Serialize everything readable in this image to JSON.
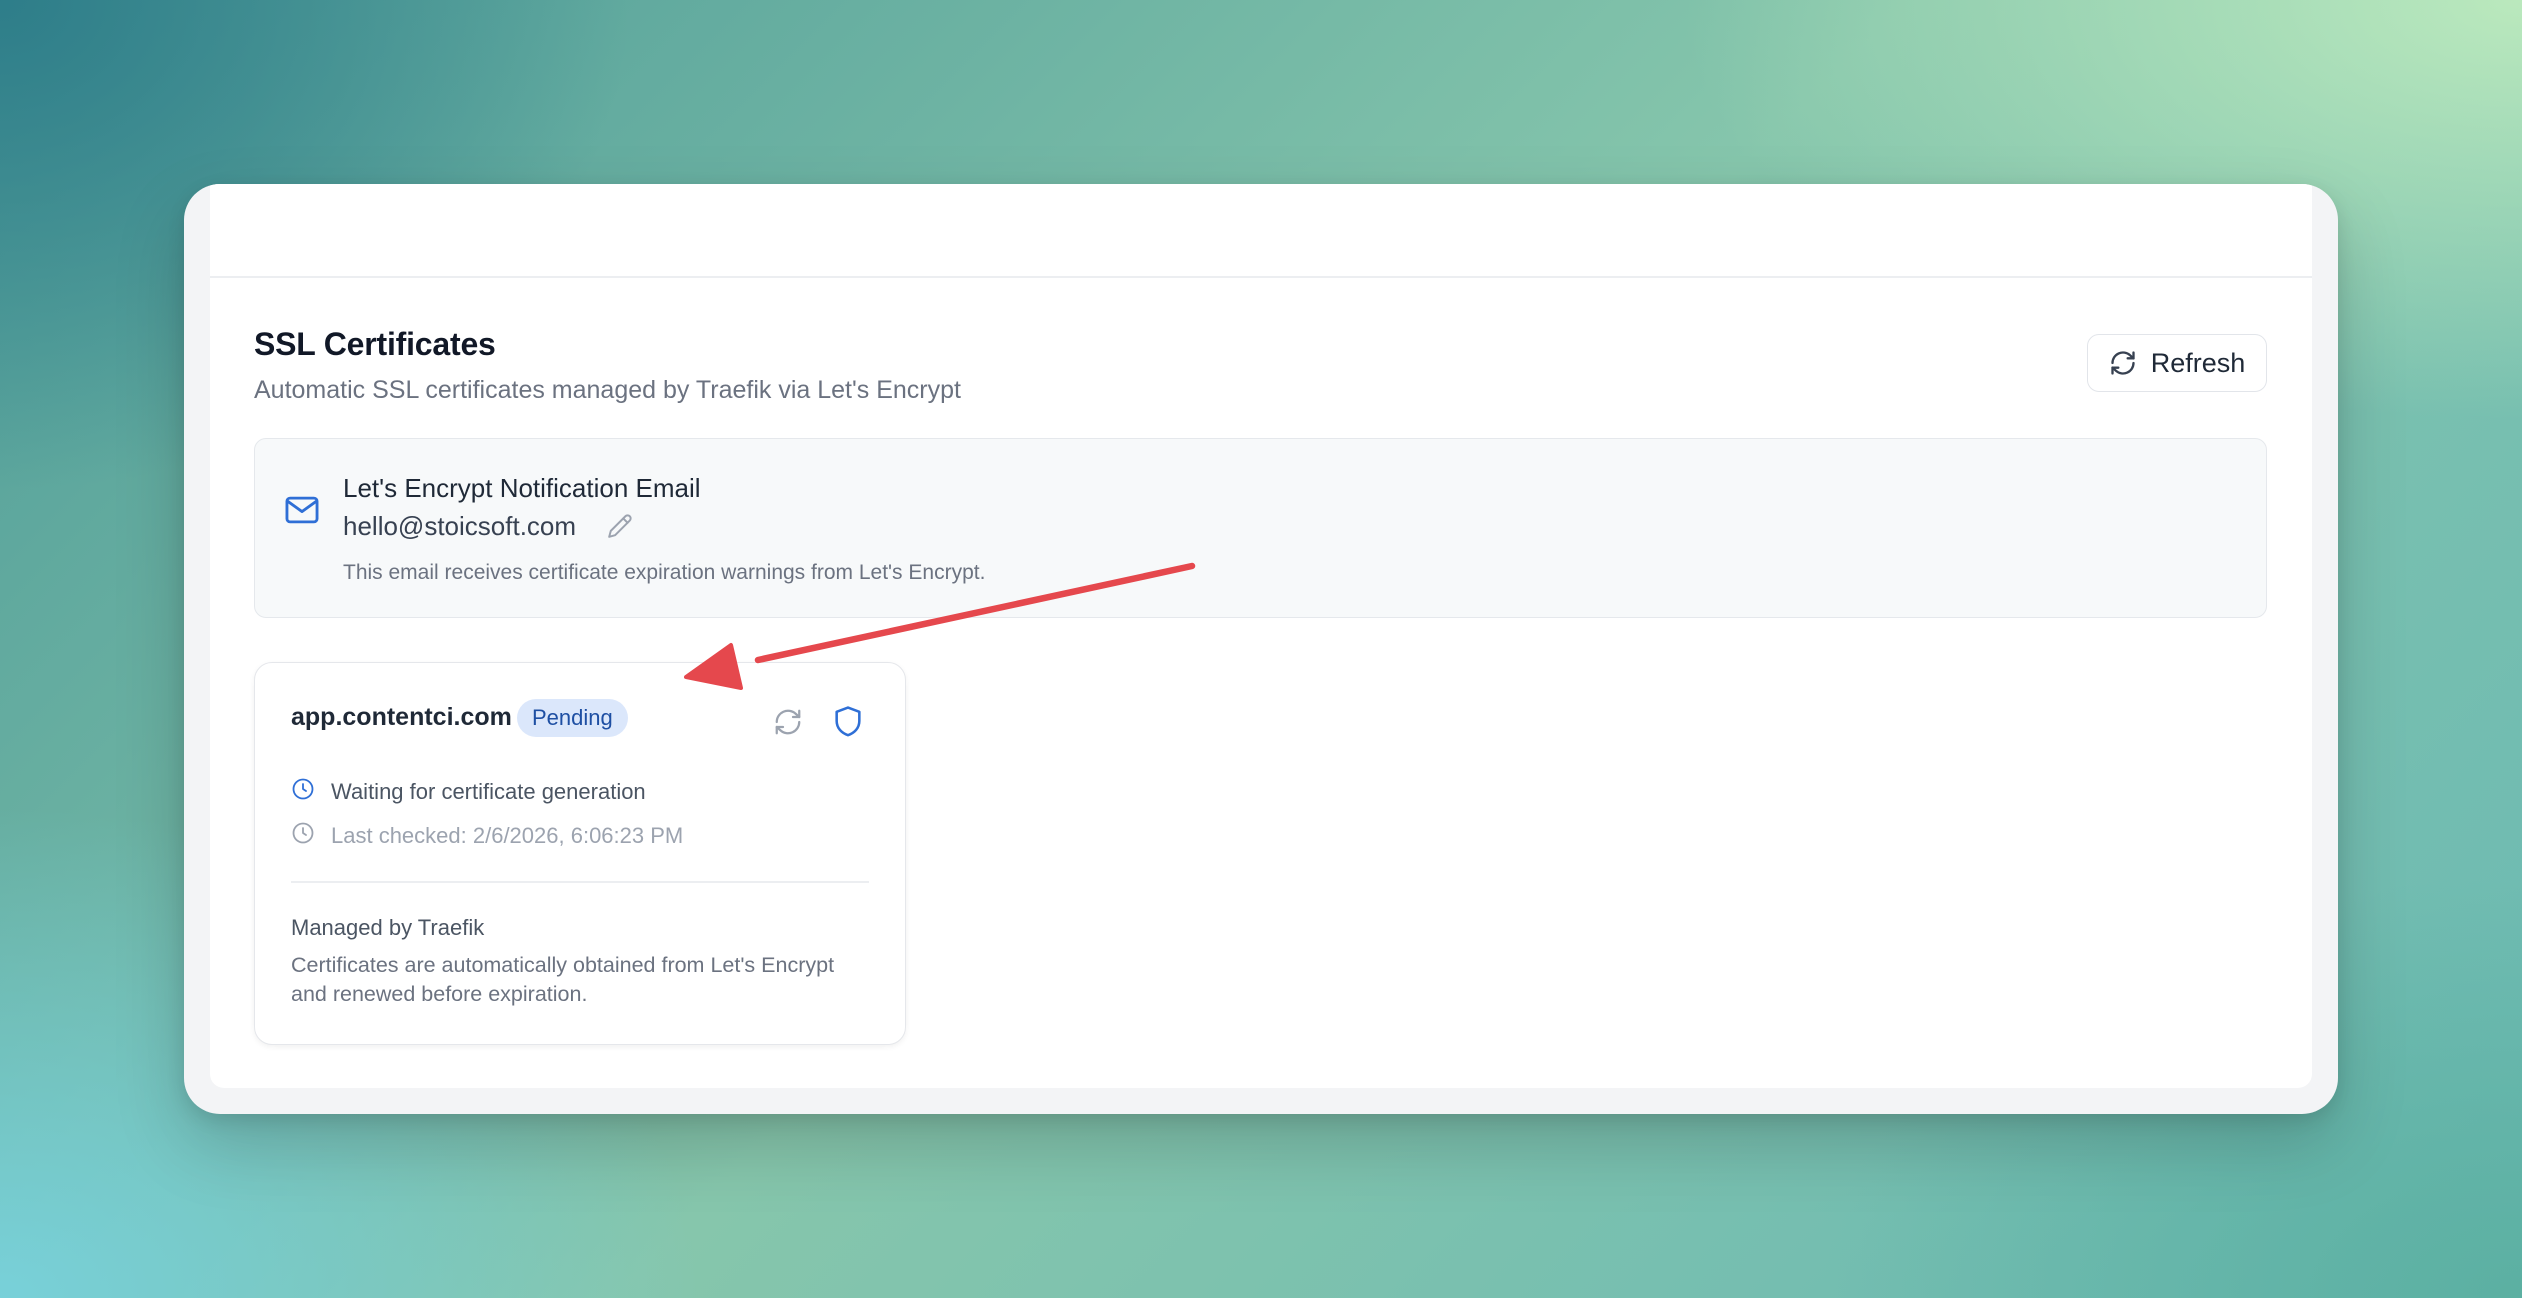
{
  "page": {
    "title": "SSL Certificates",
    "subtitle": "Automatic SSL certificates managed by Traefik via Let's Encrypt",
    "refresh_label": "Refresh"
  },
  "email_section": {
    "heading": "Let's Encrypt Notification Email",
    "email": "hello@stoicsoft.com",
    "note": "This email receives certificate expiration warnings from Let's Encrypt."
  },
  "certificate": {
    "domain": "app.contentci.com",
    "status": "Pending",
    "status_message": "Waiting for certificate generation",
    "last_checked": "Last checked: 2/6/2026, 6:06:23 PM",
    "managed_title": "Managed by Traefik",
    "managed_description": "Certificates are automatically obtained from Let's Encrypt and renewed before expiration."
  },
  "icons": {
    "refresh": "refresh-icon",
    "mail": "mail-icon",
    "edit": "pencil-icon",
    "shield": "shield-icon",
    "clock": "clock-icon"
  },
  "colors": {
    "accent_blue": "#2f6fd6",
    "badge_bg": "#dbe7fb",
    "badge_text": "#1e4fa3",
    "annotation_arrow": "#e5484d"
  }
}
